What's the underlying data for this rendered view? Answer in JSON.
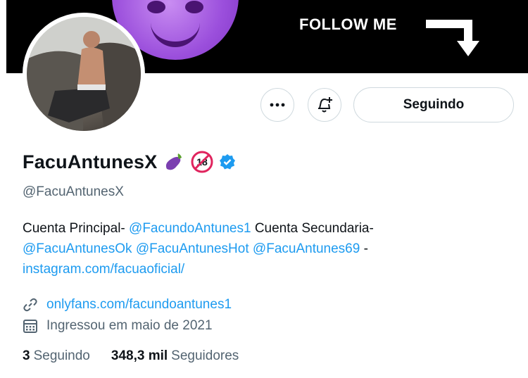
{
  "banner": {
    "text": "FOLLOW ME",
    "emoji_icon": "smiling-devil-emoji",
    "arrow_icon": "arrow-down-right-icon",
    "colors": {
      "background": "#000000",
      "emoji": "#9b4fdc"
    }
  },
  "avatar": {
    "icon": "profile-photo"
  },
  "actions": {
    "more_icon": "more-horizontal-icon",
    "notify_icon": "bell-plus-icon",
    "follow_label": "Seguindo"
  },
  "profile": {
    "display_name": "FacuAntunesX",
    "name_emojis": [
      "eggplant-emoji",
      "no-under-18-emoji"
    ],
    "verified_icon": "verified-badge-icon",
    "handle": "@FacuAntunesX"
  },
  "bio": {
    "t1": "Cuenta Principal- ",
    "m1": "@FacundoAntunes1",
    "t2": " Cuenta Secundaria- ",
    "m2": "@FacuAntunesOk",
    "m3": "@FacuAntunesHot",
    "m4": "@FacuAntunes69",
    "t3": " -",
    "link": "instagram.com/facuaoficial/"
  },
  "meta": {
    "website": "onlyfans.com/facundoantunes1",
    "website_icon": "link-icon",
    "joined": "Ingressou em maio de 2021",
    "joined_icon": "calendar-icon"
  },
  "stats": {
    "following_count": "3",
    "following_label": "Seguindo",
    "followers_count": "348,3 mil",
    "followers_label": "Seguidores"
  },
  "colors": {
    "accent": "#1d9bf0",
    "text": "#0f1419",
    "muted": "#536471",
    "verified": "#1d9bf0"
  }
}
